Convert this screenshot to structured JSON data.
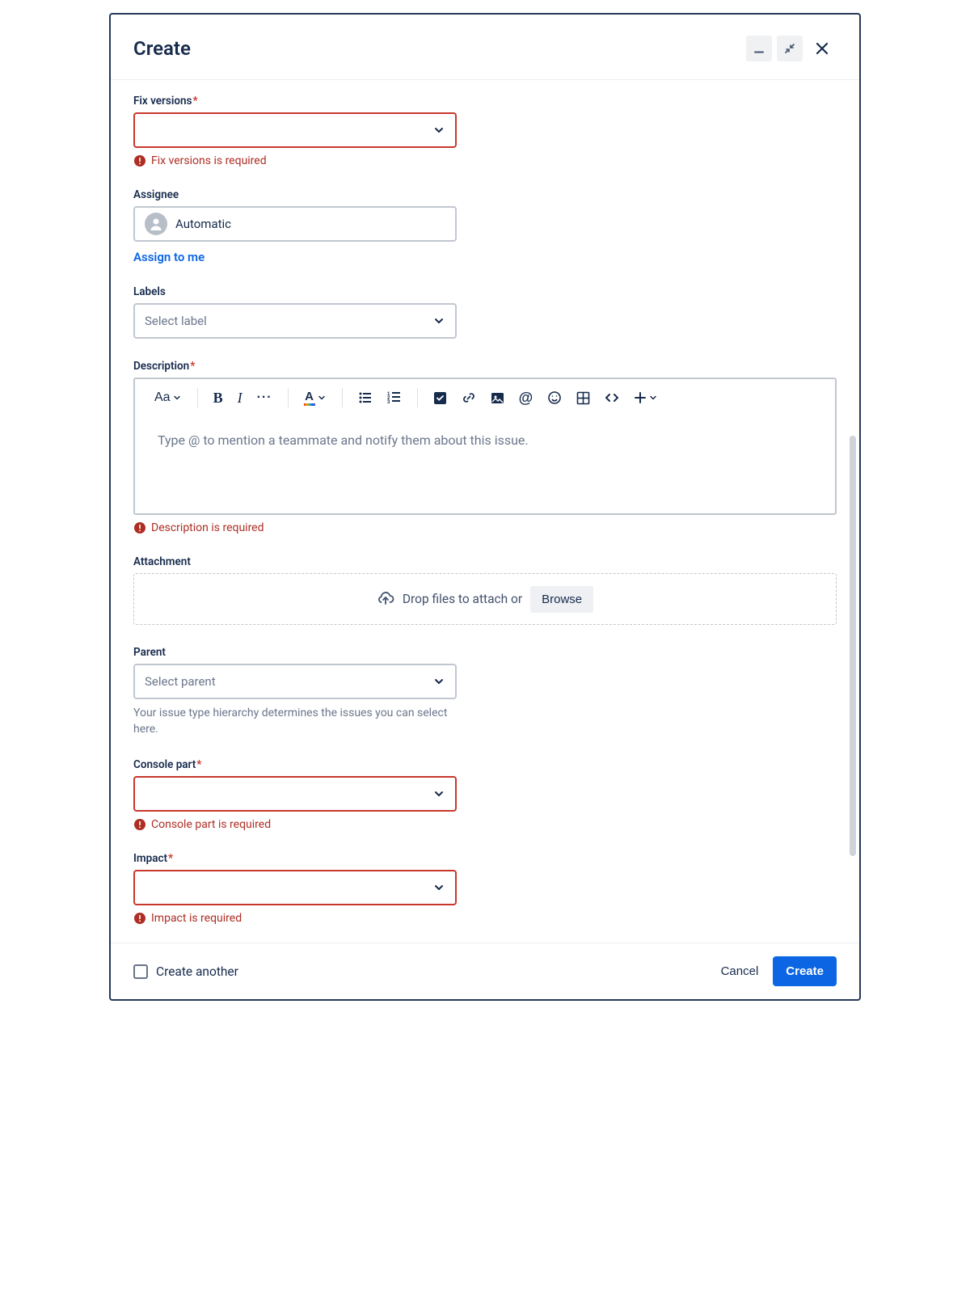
{
  "header": {
    "title": "Create"
  },
  "fields": {
    "fixVersions": {
      "label": "Fix versions",
      "required": "*",
      "error": "Fix versions is required"
    },
    "assignee": {
      "label": "Assignee",
      "value": "Automatic",
      "assignToMe": "Assign to me"
    },
    "labels": {
      "label": "Labels",
      "placeholder": "Select label"
    },
    "description": {
      "label": "Description",
      "required": "*",
      "placeholder": "Type @ to mention a teammate and notify them about this issue.",
      "error": "Description is required",
      "toolbar": {
        "textStyle": "Aa"
      }
    },
    "attachment": {
      "label": "Attachment",
      "dropText": "Drop files to attach or",
      "browse": "Browse"
    },
    "parent": {
      "label": "Parent",
      "placeholder": "Select parent",
      "help": "Your issue type hierarchy determines the issues you can select here."
    },
    "consolePart": {
      "label": "Console part",
      "required": "*",
      "error": "Console part is required"
    },
    "impact": {
      "label": "Impact",
      "required": "*",
      "error": "Impact is required"
    }
  },
  "footer": {
    "createAnother": "Create another",
    "cancel": "Cancel",
    "create": "Create"
  }
}
